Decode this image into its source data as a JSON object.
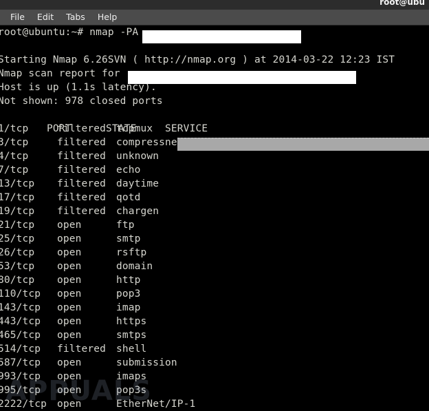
{
  "window": {
    "title": "root@ubu"
  },
  "menubar": {
    "items": [
      {
        "label": "File"
      },
      {
        "label": "Edit"
      },
      {
        "label": "Tabs"
      },
      {
        "label": "Help"
      }
    ]
  },
  "terminal": {
    "prompt_line": "root@ubuntu:~# nmap -PA",
    "blank1": " ",
    "starting_line": "Starting Nmap 6.26SVN ( http://nmap.org ) at 2014-03-22 12:23 IST",
    "scan_report_line": "Nmap scan report for",
    "host_up_line": "Host is up (1.1s latency).",
    "not_shown_line": "Not shown: 978 closed ports",
    "headers": {
      "port": "PORT",
      "state": "STATE",
      "service": "SERVICE"
    },
    "rows": [
      {
        "port": "1/tcp",
        "state": "filtered",
        "service": "tcpmux"
      },
      {
        "port": "3/tcp",
        "state": "filtered",
        "service": "compressnet"
      },
      {
        "port": "4/tcp",
        "state": "filtered",
        "service": "unknown"
      },
      {
        "port": "7/tcp",
        "state": "filtered",
        "service": "echo"
      },
      {
        "port": "13/tcp",
        "state": "filtered",
        "service": "daytime"
      },
      {
        "port": "17/tcp",
        "state": "filtered",
        "service": "qotd"
      },
      {
        "port": "19/tcp",
        "state": "filtered",
        "service": "chargen"
      },
      {
        "port": "21/tcp",
        "state": "open",
        "service": "ftp"
      },
      {
        "port": "25/tcp",
        "state": "open",
        "service": "smtp"
      },
      {
        "port": "26/tcp",
        "state": "open",
        "service": "rsftp"
      },
      {
        "port": "53/tcp",
        "state": "open",
        "service": "domain"
      },
      {
        "port": "80/tcp",
        "state": "open",
        "service": "http"
      },
      {
        "port": "110/tcp",
        "state": "open",
        "service": "pop3"
      },
      {
        "port": "143/tcp",
        "state": "open",
        "service": "imap"
      },
      {
        "port": "443/tcp",
        "state": "open",
        "service": "https"
      },
      {
        "port": "465/tcp",
        "state": "open",
        "service": "smtps"
      },
      {
        "port": "514/tcp",
        "state": "filtered",
        "service": "shell"
      },
      {
        "port": "587/tcp",
        "state": "open",
        "service": "submission"
      },
      {
        "port": "993/tcp",
        "state": "open",
        "service": "imaps"
      },
      {
        "port": "995/tcp",
        "state": "open",
        "service": "pop3s"
      },
      {
        "port": "2222/tcp",
        "state": "open",
        "service": "EtherNet/IP-1"
      }
    ]
  },
  "redactions": {
    "target_host_command": "",
    "target_host_report": "",
    "highlight_bar": ""
  },
  "watermark": {
    "text": "APPUALS"
  },
  "colors": {
    "terminal_background": "#000000",
    "terminal_text": "#d6d6cf",
    "titlebar": "#2c2c2c",
    "menubar": "#4b4b4b",
    "redact_white": "#ffffff",
    "redact_gray": "#a8a8a8"
  }
}
